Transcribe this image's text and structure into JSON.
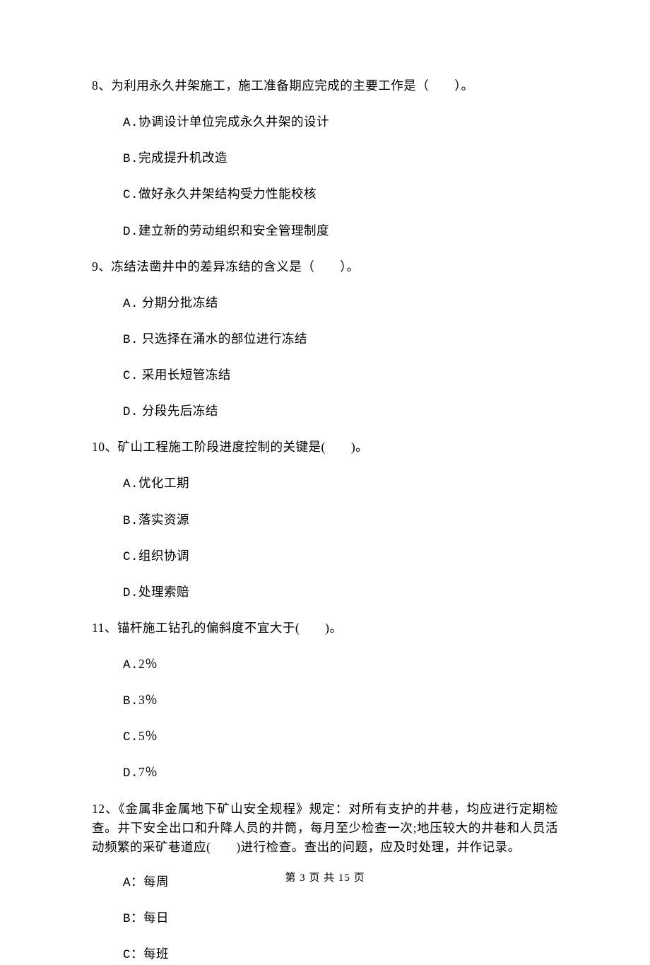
{
  "questions": [
    {
      "number": "8、",
      "stem": "为利用永久井架施工，施工准备期应完成的主要工作是（　　）。",
      "options": [
        {
          "label": "A.",
          "text": "协调设计单位完成永久井架的设计"
        },
        {
          "label": "B.",
          "text": "完成提升机改造"
        },
        {
          "label": "C.",
          "text": "做好永久井架结构受力性能校核"
        },
        {
          "label": "D.",
          "text": "建立新的劳动组织和安全管理制度"
        }
      ]
    },
    {
      "number": "9、",
      "stem": "冻结法凿井中的差异冻结的含义是（　　）。",
      "options": [
        {
          "label": "A.",
          "text": " 分期分批冻结"
        },
        {
          "label": "B.",
          "text": " 只选择在涌水的部位进行冻结"
        },
        {
          "label": "C.",
          "text": " 采用长短管冻结"
        },
        {
          "label": "D.",
          "text": " 分段先后冻结"
        }
      ]
    },
    {
      "number": "10、",
      "stem": "矿山工程施工阶段进度控制的关键是(　　)。",
      "options": [
        {
          "label": "A.",
          "text": "优化工期"
        },
        {
          "label": "B.",
          "text": "落实资源"
        },
        {
          "label": "C.",
          "text": "组织协调"
        },
        {
          "label": "D.",
          "text": "处理索赔"
        }
      ]
    },
    {
      "number": "11、",
      "stem": "锚杆施工钻孔的偏斜度不宜大于(　　)。",
      "options": [
        {
          "label": "A.",
          "text": "2％"
        },
        {
          "label": "B.",
          "text": "3％"
        },
        {
          "label": "C.",
          "text": "5％"
        },
        {
          "label": "D.",
          "text": "7％"
        }
      ]
    },
    {
      "number": "12、",
      "stem": "《金属非金属地下矿山安全规程》规定：对所有支护的井巷，均应进行定期检查。井下安全出口和升降人员的井筒，每月至少检查一次;地压较大的井巷和人员活动频繁的采矿巷道应(　　)进行检查。查出的问题，应及时处理，并作记录。",
      "options": [
        {
          "label": "A：",
          "text": "每周"
        },
        {
          "label": "B：",
          "text": "每日"
        },
        {
          "label": "C：",
          "text": "每班"
        }
      ]
    }
  ],
  "footer": "第 3 页 共 15 页"
}
